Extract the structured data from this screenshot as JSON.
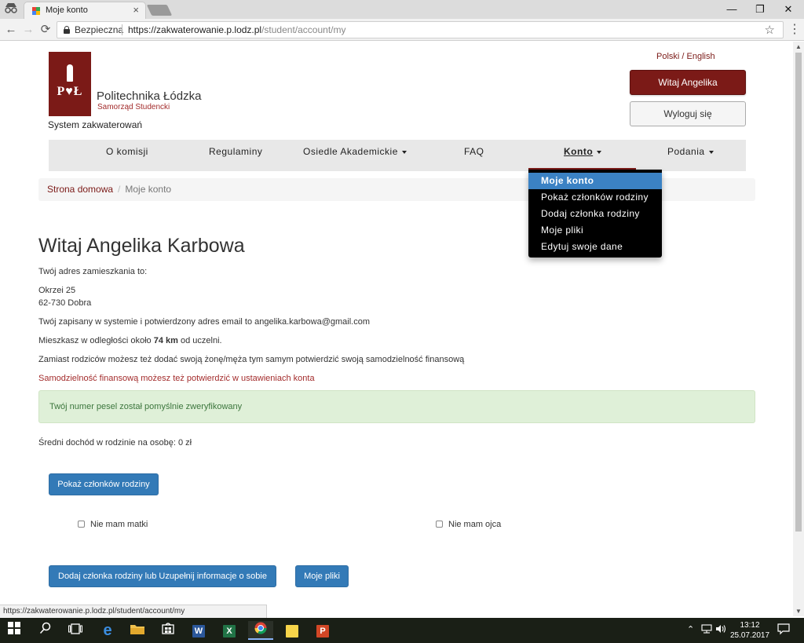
{
  "browser": {
    "tab_title": "Moje konto",
    "tab_close": "×",
    "incognito_icon": "incognito-icon",
    "win_minimize": "—",
    "win_restore": "❐",
    "win_close": "✕",
    "secure_label": "Bezpieczna",
    "url_host": "https://zakwaterowanie.p.lodz.pl",
    "url_path": "/student/account/my",
    "status_url": "https://zakwaterowanie.p.lodz.pl/student/account/my"
  },
  "header": {
    "logo_text": "P♥Ł",
    "university_name": "Politechnika Łódzka",
    "university_sub": "Samorząd Studencki",
    "system_name": "System zakwaterowań",
    "language": "Polski / English",
    "welcome_button": "Witaj Angelika",
    "logout_button": "Wyloguj się"
  },
  "nav": {
    "items": [
      {
        "label": "O komisji"
      },
      {
        "label": "Regulaminy"
      },
      {
        "label": "Osiedle Akademickie"
      },
      {
        "label": "FAQ"
      },
      {
        "label": "Konto"
      },
      {
        "label": "Podania"
      }
    ],
    "active": "Konto",
    "dropdown": [
      {
        "label": "Moje konto"
      },
      {
        "label": "Pokaż członków rodziny"
      },
      {
        "label": "Dodaj członka rodziny"
      },
      {
        "label": "Moje pliki"
      },
      {
        "label": "Edytuj swoje dane"
      }
    ]
  },
  "breadcrumb": {
    "home": "Strona domowa",
    "separator": "/",
    "current": "Moje konto"
  },
  "content": {
    "heading": "Witaj Angelika Karbowa",
    "address_intro": "Twój adres zamieszkania to:",
    "address_line1": "Okrzei 25",
    "address_line2": "62-730 Dobra",
    "email_line": "Twój zapisany w systemie i potwierdzony adres email to angelika.karbowa@gmail.com",
    "distance_prefix": "Mieszkasz w odległości około ",
    "distance_value": "74 km",
    "distance_suffix": " od uczelni.",
    "spouse_info": "Zamiast rodziców możesz też dodać swoją żonę/męża tym samym potwierdzić swoją samodzielność finansową",
    "financial_info": "Samodzielność finansową możesz też potwierdzić w ustawieniach konta",
    "alert": "Twój numer pesel został pomyślnie zweryfikowany",
    "income": "Średni dochód w rodzinie na osobę: 0 zł",
    "show_family_button": "Pokaż członków rodziny",
    "no_mother": "Nie mam matki",
    "no_father": "Nie mam ojca",
    "add_family_button": "Dodaj członka rodziny lub Uzupełnij informacje o sobie",
    "my_files_button": "Moje pliki"
  },
  "taskbar": {
    "time": "13:12",
    "date": "25.07.2017"
  }
}
